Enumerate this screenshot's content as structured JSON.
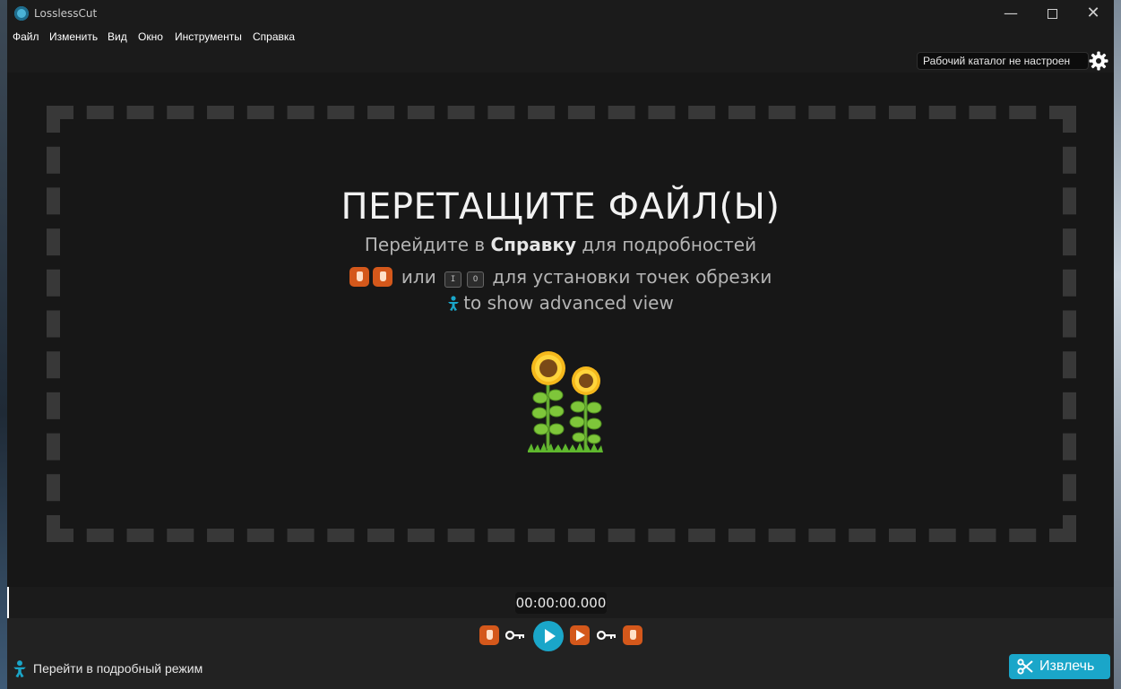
{
  "window": {
    "title": "LosslessCut"
  },
  "menu": [
    "Файл",
    "Изменить",
    "Вид",
    "Окно",
    "Инструменты",
    "Справка"
  ],
  "toolbar": {
    "working_dir": "Рабочий каталог не настроен"
  },
  "dropzone": {
    "title": "ПЕРЕТАЩИТЕ ФАЙЛ(Ы)",
    "help_prefix": "Перейдите в ",
    "help_bold": "Справку",
    "help_suffix": " для подробностей",
    "or_text": " или ",
    "key_in": "I",
    "key_out": "O",
    "cutpoints_text": "для установки точек обрезки",
    "advanced_hint": "to show advanced view"
  },
  "timeline": {
    "timecode": "00:00:00.000"
  },
  "bottom": {
    "simple_mode_label": "Перейти в подробный режим",
    "export_label": "Извлечь"
  },
  "colors": {
    "accent": "#1aa6c9",
    "cutpoint": "#d4581b"
  },
  "icons": {
    "settings": "gear-icon",
    "export": "scissors-icon",
    "advanced": "baby-icon",
    "illustration": "sunflower-icon"
  }
}
